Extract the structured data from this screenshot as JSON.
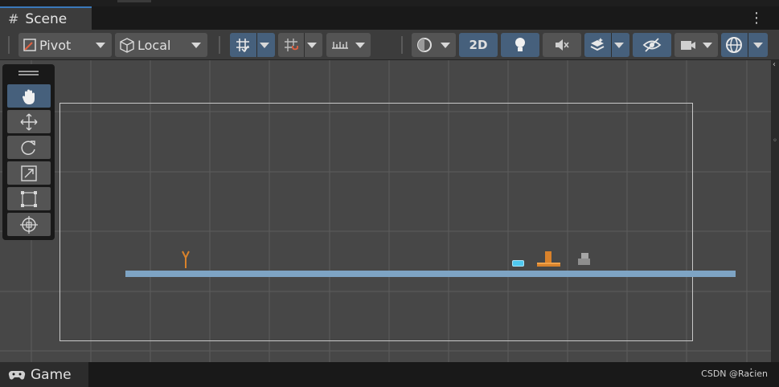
{
  "tabs": {
    "scene": "Scene",
    "game": "Game"
  },
  "toolbar": {
    "pivot": "Pivot",
    "local": "Local",
    "mode_2d": "2D"
  },
  "icons": {
    "scene_tab": "hash-grid-icon",
    "game_tab": "gamepad-icon",
    "more": "kebab-menu-icon",
    "tools": [
      "hand-icon",
      "move-icon",
      "rotate-icon",
      "scale-icon",
      "rect-icon",
      "transform-icon"
    ]
  },
  "watermark": "CSDN @Racien",
  "colors": {
    "accent": "#3a79bb",
    "active_button": "#46607c",
    "ground": "#7ea4c4",
    "orange": "#d9822b",
    "cyan": "#4fc8ef"
  }
}
